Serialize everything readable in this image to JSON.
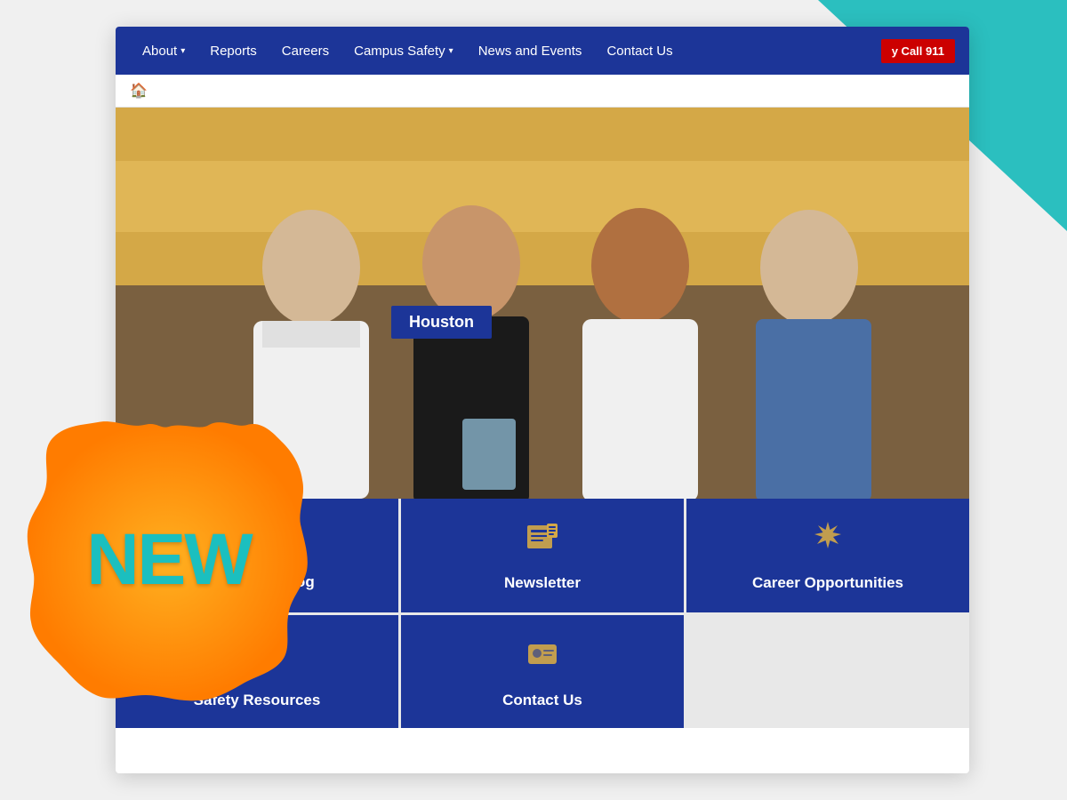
{
  "nav": {
    "items": [
      {
        "label": "About",
        "has_dropdown": true
      },
      {
        "label": "Reports",
        "has_dropdown": false
      },
      {
        "label": "Careers",
        "has_dropdown": false
      },
      {
        "label": "Campus Safety",
        "has_dropdown": true
      },
      {
        "label": "News and Events",
        "has_dropdown": false
      },
      {
        "label": "Contact Us",
        "has_dropdown": false
      }
    ],
    "emergency_label": "y Call 911"
  },
  "breadcrumb": {
    "home_icon": "🏠"
  },
  "hero": {
    "location_label": "Houston"
  },
  "new_badge": {
    "label": "NEW"
  },
  "quick_links": [
    {
      "id": "daily-crime-log",
      "label": "Daily Crime Log",
      "icon": "📋"
    },
    {
      "id": "newsletter",
      "label": "Newsletter",
      "icon": "📰"
    },
    {
      "id": "career-opportunities",
      "label": "Career Opportunities",
      "icon": "✦"
    },
    {
      "id": "safety-resources",
      "label": "Safety Resources",
      "icon": "👤🛡"
    },
    {
      "id": "contact-us",
      "label": "Contact Us",
      "icon": "🪪"
    }
  ]
}
